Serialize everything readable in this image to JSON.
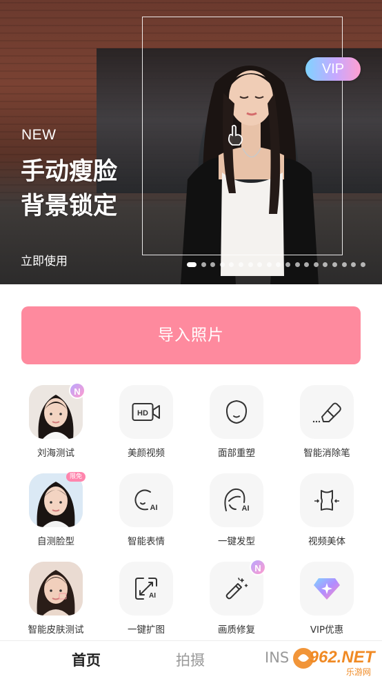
{
  "banner": {
    "new_label": "NEW",
    "title_line1": "手动瘦脸",
    "title_line2": "背景锁定",
    "cta": "立即使用",
    "vip_badge": "VIP",
    "slide_count": 19,
    "active_slide": 1
  },
  "import_button": "导入照片",
  "features": [
    {
      "label": "刘海测试",
      "icon": "portrait-photo-icon",
      "badge": "N"
    },
    {
      "label": "美颜视频",
      "icon": "hd-video-icon"
    },
    {
      "label": "面部重塑",
      "icon": "face-outline-icon"
    },
    {
      "label": "智能消除笔",
      "icon": "eraser-icon"
    },
    {
      "label": "自测脸型",
      "icon": "portrait-photo-icon",
      "badge": "限免"
    },
    {
      "label": "智能表情",
      "icon": "ai-expression-icon"
    },
    {
      "label": "一键发型",
      "icon": "ai-hairstyle-icon"
    },
    {
      "label": "视频美体",
      "icon": "body-shape-icon"
    },
    {
      "label": "智能皮肤测试",
      "icon": "portrait-photo-icon"
    },
    {
      "label": "一键扩图",
      "icon": "ai-expand-icon"
    },
    {
      "label": "画质修复",
      "icon": "magic-wand-icon",
      "badge": "N"
    },
    {
      "label": "VIP优惠",
      "icon": "diamond-icon"
    }
  ],
  "nav": {
    "home": "首页",
    "camera": "拍摄",
    "third": "INS"
  },
  "watermark": {
    "site": "962.NET",
    "sub": "乐游网"
  },
  "colors": {
    "primary": "#fe8a9e",
    "badge_gradient": [
      "#b9a6ff",
      "#ff9ccd"
    ]
  }
}
